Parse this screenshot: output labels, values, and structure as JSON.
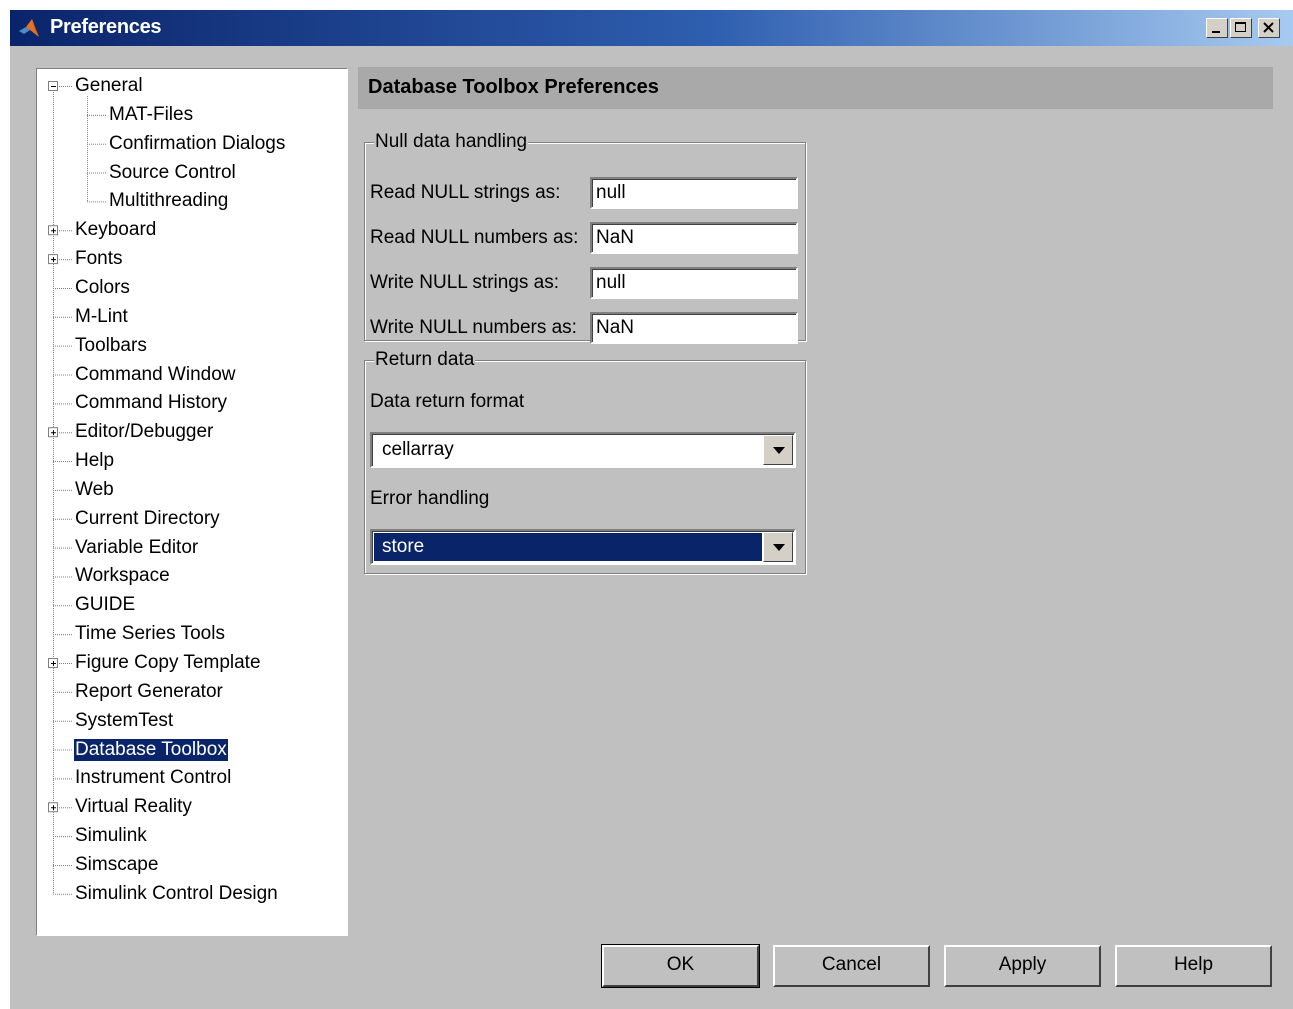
{
  "window": {
    "title": "Preferences"
  },
  "tree": {
    "nodes": [
      {
        "label": "General",
        "level": 0,
        "expander": "minus"
      },
      {
        "label": "MAT-Files",
        "level": 1
      },
      {
        "label": "Confirmation Dialogs",
        "level": 1
      },
      {
        "label": "Source Control",
        "level": 1
      },
      {
        "label": "Multithreading",
        "level": 1
      },
      {
        "label": "Keyboard",
        "level": 0,
        "expander": "plus"
      },
      {
        "label": "Fonts",
        "level": 0,
        "expander": "plus"
      },
      {
        "label": "Colors",
        "level": 0
      },
      {
        "label": "M-Lint",
        "level": 0
      },
      {
        "label": "Toolbars",
        "level": 0
      },
      {
        "label": "Command Window",
        "level": 0
      },
      {
        "label": "Command History",
        "level": 0
      },
      {
        "label": "Editor/Debugger",
        "level": 0,
        "expander": "plus"
      },
      {
        "label": "Help",
        "level": 0
      },
      {
        "label": "Web",
        "level": 0
      },
      {
        "label": "Current Directory",
        "level": 0
      },
      {
        "label": "Variable Editor",
        "level": 0
      },
      {
        "label": "Workspace",
        "level": 0
      },
      {
        "label": "GUIDE",
        "level": 0
      },
      {
        "label": "Time Series Tools",
        "level": 0
      },
      {
        "label": "Figure Copy Template",
        "level": 0,
        "expander": "plus"
      },
      {
        "label": "Report Generator",
        "level": 0
      },
      {
        "label": "SystemTest",
        "level": 0
      },
      {
        "label": "Database Toolbox",
        "level": 0,
        "selected": true
      },
      {
        "label": "Instrument Control",
        "level": 0
      },
      {
        "label": "Virtual Reality",
        "level": 0,
        "expander": "plus"
      },
      {
        "label": "Simulink",
        "level": 0
      },
      {
        "label": "Simscape",
        "level": 0
      },
      {
        "label": "Simulink Control Design",
        "level": 0
      }
    ]
  },
  "panel": {
    "title": "Database Toolbox Preferences",
    "null_group": {
      "legend": "Null data handling",
      "read_null_strings_label": "Read NULL strings as:",
      "read_null_strings_value": "null",
      "read_null_numbers_label": "Read NULL numbers as:",
      "read_null_numbers_value": "NaN",
      "write_null_strings_label": "Write NULL strings as:",
      "write_null_strings_value": "null",
      "write_null_numbers_label": "Write NULL numbers as:",
      "write_null_numbers_value": "NaN"
    },
    "return_group": {
      "legend": "Return data",
      "format_label": "Data return format",
      "format_value": "cellarray",
      "error_label": "Error handling",
      "error_value": "store"
    }
  },
  "buttons": {
    "ok": "OK",
    "cancel": "Cancel",
    "apply": "Apply",
    "help": "Help"
  }
}
